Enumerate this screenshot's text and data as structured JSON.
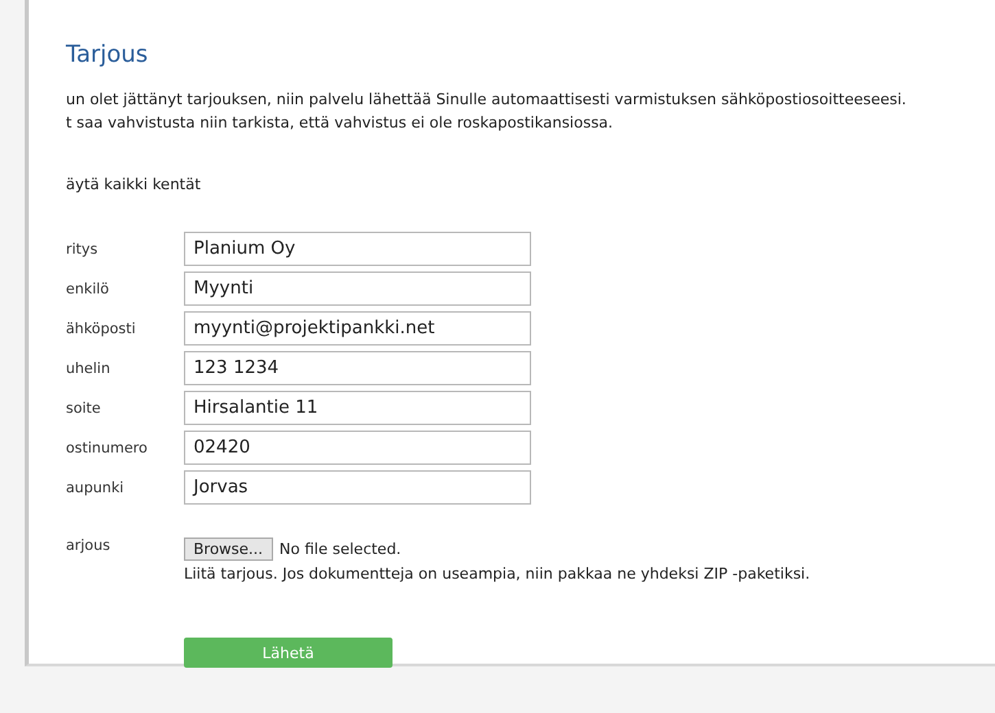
{
  "heading": "Tarjous",
  "intro": [
    "un olet jättänyt tarjouksen, niin palvelu lähettää Sinulle automaattisesti varmistuksen sähköpostiosoitteeseesi.",
    "t saa vahvistusta niin tarkista, että vahvistus ei ole roskapostikansiossa."
  ],
  "required_note": "äytä kaikki kentät",
  "fields": [
    {
      "label": "ritys",
      "value": "Planium Oy"
    },
    {
      "label": "enkilö",
      "value": "Myynti"
    },
    {
      "label": "ähköposti",
      "value": "myynti@projektipankki.net"
    },
    {
      "label": "uhelin",
      "value": "123 1234"
    },
    {
      "label": "soite",
      "value": "Hirsalantie 11"
    },
    {
      "label": "ostinumero",
      "value": "02420"
    },
    {
      "label": "aupunki",
      "value": "Jorvas"
    }
  ],
  "file": {
    "label": "arjous",
    "button": "Browse...",
    "status": "No file selected.",
    "hint": "Liitä tarjous. Jos dokumentteja on useampia, niin pakkaa ne yhdeksi ZIP -paketiksi."
  },
  "submit": "Lähetä"
}
